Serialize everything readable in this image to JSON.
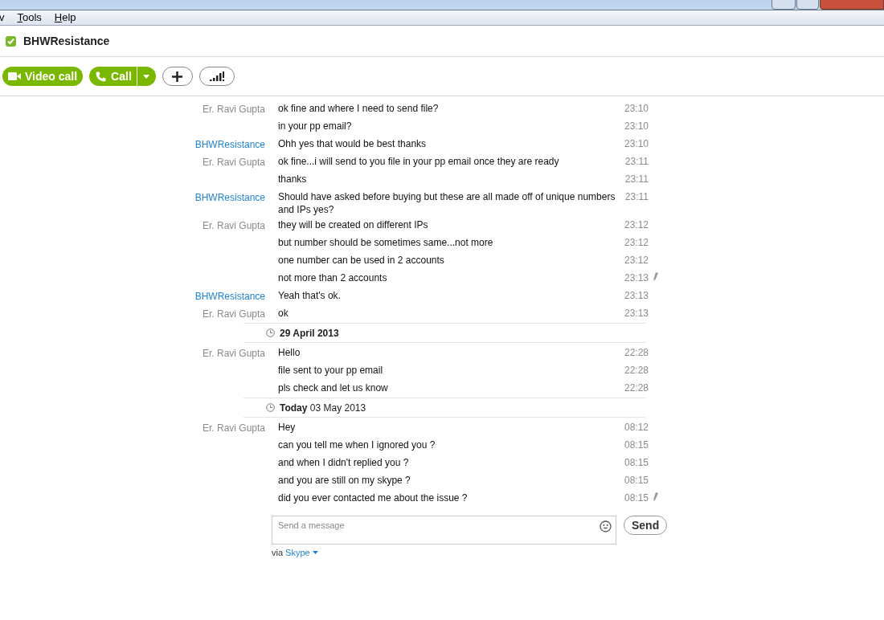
{
  "menu": [
    {
      "label": "v",
      "mnemonic": false
    },
    {
      "label": "Tools",
      "mnemonic": true
    },
    {
      "label": "Help",
      "mnemonic": true
    }
  ],
  "contact": {
    "name": "BHWResistance"
  },
  "toolbar": {
    "video_call": "Video call",
    "call": "Call"
  },
  "conversation": [
    {
      "kind": "message",
      "sender": "Er. Ravi Gupta",
      "color": "#8a8a8a",
      "text": "ok fine and where I need to send file?",
      "time": "23:10",
      "edited": false
    },
    {
      "kind": "message",
      "text": "in your pp email?",
      "time": "23:10",
      "edited": false
    },
    {
      "kind": "message",
      "sender": "BHWResistance",
      "color": "#1f83d4",
      "text": "Ohh yes that would be best thanks",
      "time": "23:10",
      "edited": false
    },
    {
      "kind": "message",
      "sender": "Er. Ravi Gupta",
      "color": "#8a8a8a",
      "text": "ok fine...i will send to you file in your pp email once they are ready",
      "time": "23:11",
      "edited": false
    },
    {
      "kind": "message",
      "text": "thanks",
      "time": "23:11",
      "edited": false
    },
    {
      "kind": "message",
      "sender": "BHWResistance",
      "color": "#1f83d4",
      "text": "Should have asked before buying but these are all made off of unique numbers and IPs yes?",
      "time": "23:11",
      "edited": false
    },
    {
      "kind": "message",
      "sender": "Er. Ravi Gupta",
      "color": "#8a8a8a",
      "text": "they will be created on different IPs",
      "time": "23:12",
      "edited": false
    },
    {
      "kind": "message",
      "text": "but number should be sometimes same...not more",
      "time": "23:12",
      "edited": false
    },
    {
      "kind": "message",
      "text": "one number can be used in 2 accounts",
      "time": "23:12",
      "edited": false
    },
    {
      "kind": "message",
      "text": "not more than 2 accounts",
      "time": "23:13",
      "edited": true
    },
    {
      "kind": "message",
      "sender": "BHWResistance",
      "color": "#1f83d4",
      "text": "Yeah that's ok.",
      "time": "23:13",
      "edited": false
    },
    {
      "kind": "message",
      "sender": "Er. Ravi Gupta",
      "color": "#8a8a8a",
      "text": "ok",
      "time": "23:13",
      "edited": false
    },
    {
      "kind": "date",
      "text": "**29 April 2013**"
    },
    {
      "kind": "message",
      "sender": "Er. Ravi Gupta",
      "color": "#8a8a8a",
      "text": "Hello",
      "time": "22:28",
      "edited": false
    },
    {
      "kind": "message",
      "text": "file sent to your pp email",
      "time": "22:28",
      "edited": false
    },
    {
      "kind": "message",
      "text": "pls check and let us know",
      "time": "22:28",
      "edited": false
    },
    {
      "kind": "date",
      "text": "**Today** 03 May 2013"
    },
    {
      "kind": "message",
      "sender": "Er. Ravi Gupta",
      "color": "#8a8a8a",
      "text": "Hey",
      "time": "08:12",
      "edited": false
    },
    {
      "kind": "message",
      "text": "can you tell me when I ignored you ?",
      "time": "08:15",
      "edited": false
    },
    {
      "kind": "message",
      "text": "and when I didn't replied you ?",
      "time": "08:15",
      "edited": false
    },
    {
      "kind": "message",
      "text": "and you are still on my skype ?",
      "time": "08:15",
      "edited": false
    },
    {
      "kind": "message",
      "text": "did you ever contacted me about the issue ?",
      "time": "08:15",
      "edited": true
    }
  ],
  "composer": {
    "placeholder": "Send a message",
    "send": "Send",
    "via": "via",
    "via_link": "Skype"
  }
}
